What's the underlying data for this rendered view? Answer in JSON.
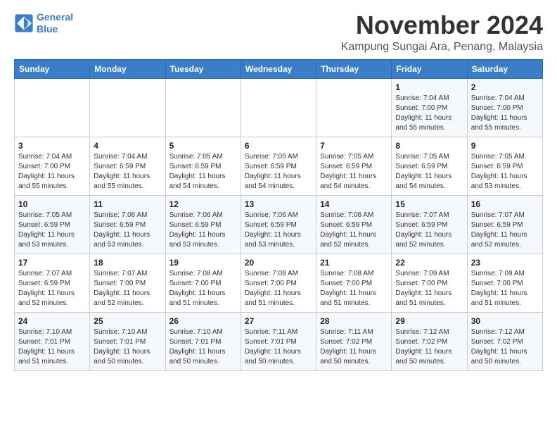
{
  "header": {
    "logo_line1": "General",
    "logo_line2": "Blue",
    "month": "November 2024",
    "location": "Kampung Sungai Ara, Penang, Malaysia"
  },
  "weekdays": [
    "Sunday",
    "Monday",
    "Tuesday",
    "Wednesday",
    "Thursday",
    "Friday",
    "Saturday"
  ],
  "weeks": [
    [
      {
        "day": "",
        "info": ""
      },
      {
        "day": "",
        "info": ""
      },
      {
        "day": "",
        "info": ""
      },
      {
        "day": "",
        "info": ""
      },
      {
        "day": "",
        "info": ""
      },
      {
        "day": "1",
        "info": "Sunrise: 7:04 AM\nSunset: 7:00 PM\nDaylight: 11 hours and 55 minutes."
      },
      {
        "day": "2",
        "info": "Sunrise: 7:04 AM\nSunset: 7:00 PM\nDaylight: 11 hours and 55 minutes."
      }
    ],
    [
      {
        "day": "3",
        "info": "Sunrise: 7:04 AM\nSunset: 7:00 PM\nDaylight: 11 hours and 55 minutes."
      },
      {
        "day": "4",
        "info": "Sunrise: 7:04 AM\nSunset: 6:59 PM\nDaylight: 11 hours and 55 minutes."
      },
      {
        "day": "5",
        "info": "Sunrise: 7:05 AM\nSunset: 6:59 PM\nDaylight: 11 hours and 54 minutes."
      },
      {
        "day": "6",
        "info": "Sunrise: 7:05 AM\nSunset: 6:59 PM\nDaylight: 11 hours and 54 minutes."
      },
      {
        "day": "7",
        "info": "Sunrise: 7:05 AM\nSunset: 6:59 PM\nDaylight: 11 hours and 54 minutes."
      },
      {
        "day": "8",
        "info": "Sunrise: 7:05 AM\nSunset: 6:59 PM\nDaylight: 11 hours and 54 minutes."
      },
      {
        "day": "9",
        "info": "Sunrise: 7:05 AM\nSunset: 6:59 PM\nDaylight: 11 hours and 53 minutes."
      }
    ],
    [
      {
        "day": "10",
        "info": "Sunrise: 7:05 AM\nSunset: 6:59 PM\nDaylight: 11 hours and 53 minutes."
      },
      {
        "day": "11",
        "info": "Sunrise: 7:06 AM\nSunset: 6:59 PM\nDaylight: 11 hours and 53 minutes."
      },
      {
        "day": "12",
        "info": "Sunrise: 7:06 AM\nSunset: 6:59 PM\nDaylight: 11 hours and 53 minutes."
      },
      {
        "day": "13",
        "info": "Sunrise: 7:06 AM\nSunset: 6:59 PM\nDaylight: 11 hours and 53 minutes."
      },
      {
        "day": "14",
        "info": "Sunrise: 7:06 AM\nSunset: 6:59 PM\nDaylight: 11 hours and 52 minutes."
      },
      {
        "day": "15",
        "info": "Sunrise: 7:07 AM\nSunset: 6:59 PM\nDaylight: 11 hours and 52 minutes."
      },
      {
        "day": "16",
        "info": "Sunrise: 7:07 AM\nSunset: 6:59 PM\nDaylight: 11 hours and 52 minutes."
      }
    ],
    [
      {
        "day": "17",
        "info": "Sunrise: 7:07 AM\nSunset: 6:59 PM\nDaylight: 11 hours and 52 minutes."
      },
      {
        "day": "18",
        "info": "Sunrise: 7:07 AM\nSunset: 7:00 PM\nDaylight: 11 hours and 52 minutes."
      },
      {
        "day": "19",
        "info": "Sunrise: 7:08 AM\nSunset: 7:00 PM\nDaylight: 11 hours and 51 minutes."
      },
      {
        "day": "20",
        "info": "Sunrise: 7:08 AM\nSunset: 7:00 PM\nDaylight: 11 hours and 51 minutes."
      },
      {
        "day": "21",
        "info": "Sunrise: 7:08 AM\nSunset: 7:00 PM\nDaylight: 11 hours and 51 minutes."
      },
      {
        "day": "22",
        "info": "Sunrise: 7:09 AM\nSunset: 7:00 PM\nDaylight: 11 hours and 51 minutes."
      },
      {
        "day": "23",
        "info": "Sunrise: 7:09 AM\nSunset: 7:00 PM\nDaylight: 11 hours and 51 minutes."
      }
    ],
    [
      {
        "day": "24",
        "info": "Sunrise: 7:10 AM\nSunset: 7:01 PM\nDaylight: 11 hours and 51 minutes."
      },
      {
        "day": "25",
        "info": "Sunrise: 7:10 AM\nSunset: 7:01 PM\nDaylight: 11 hours and 50 minutes."
      },
      {
        "day": "26",
        "info": "Sunrise: 7:10 AM\nSunset: 7:01 PM\nDaylight: 11 hours and 50 minutes."
      },
      {
        "day": "27",
        "info": "Sunrise: 7:11 AM\nSunset: 7:01 PM\nDaylight: 11 hours and 50 minutes."
      },
      {
        "day": "28",
        "info": "Sunrise: 7:11 AM\nSunset: 7:02 PM\nDaylight: 11 hours and 50 minutes."
      },
      {
        "day": "29",
        "info": "Sunrise: 7:12 AM\nSunset: 7:02 PM\nDaylight: 11 hours and 50 minutes."
      },
      {
        "day": "30",
        "info": "Sunrise: 7:12 AM\nSunset: 7:02 PM\nDaylight: 11 hours and 50 minutes."
      }
    ]
  ]
}
